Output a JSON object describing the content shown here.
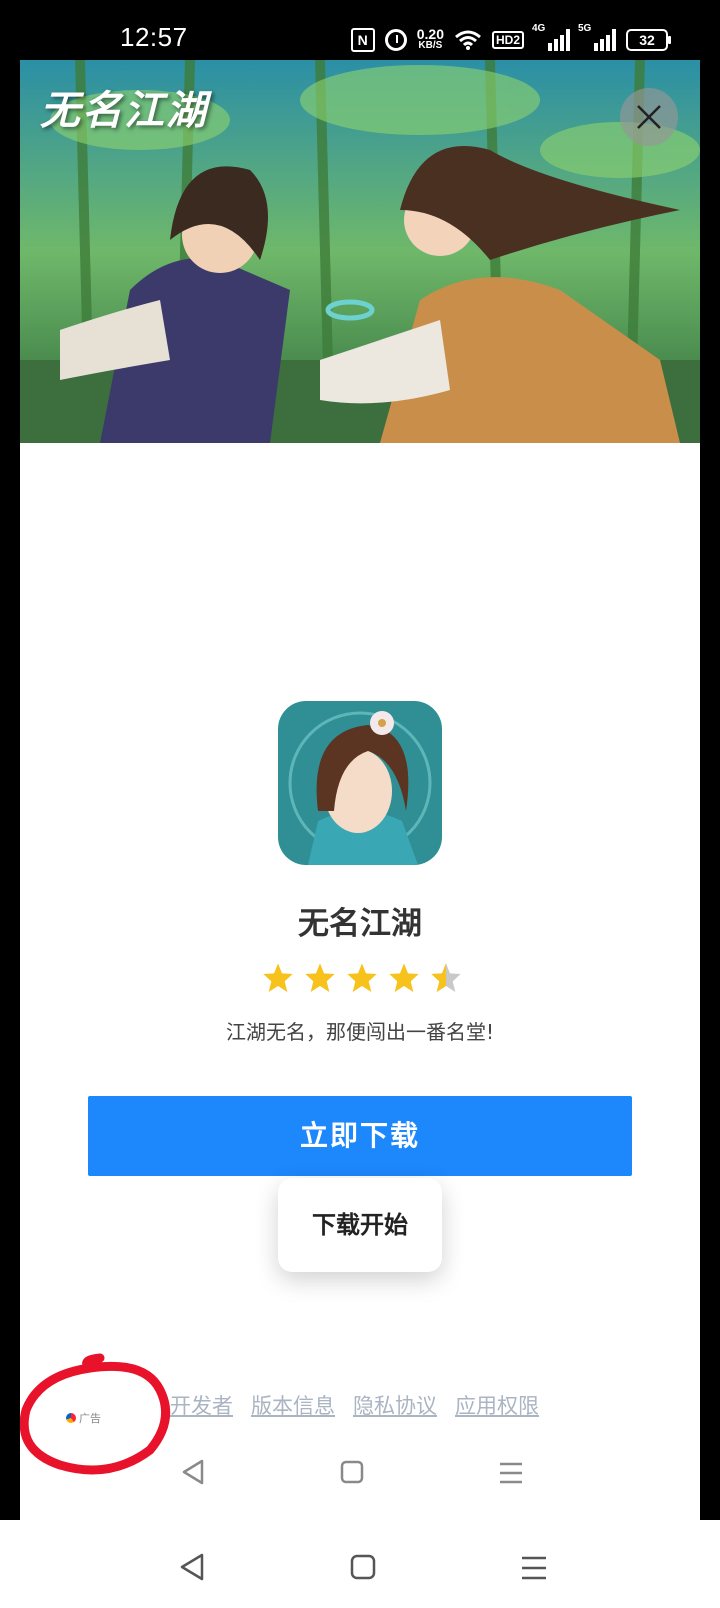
{
  "status_bar": {
    "time": "12:57",
    "nfc": "N",
    "speed_value": "0.20",
    "speed_unit": "KB/S",
    "hd_label": "HD2",
    "sim1_label": "4G",
    "sim2_label": "5G",
    "battery": "32"
  },
  "ad": {
    "banner_logo": "无名江湖",
    "app_name": "无名江湖",
    "rating_stars": 4.5,
    "slogan": "江湖无名，那便闯出一番名堂!",
    "download_button": "立即下载",
    "toast": "下载开始",
    "links": [
      "开发者",
      "版本信息",
      "隐私协议",
      "应用权限"
    ],
    "ad_label": "广告",
    "annotation_color": "#e8132a",
    "button_color": "#1d87fc"
  }
}
